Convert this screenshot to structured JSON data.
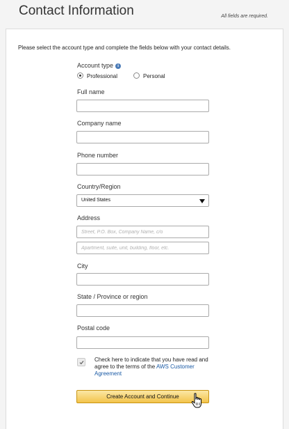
{
  "header": {
    "title": "Contact Information",
    "required_note": "All fields are required."
  },
  "intro": "Please select the account type and complete the fields below with your contact details.",
  "account_type": {
    "label": "Account type",
    "info_icon": "i",
    "options": [
      {
        "label": "Professional",
        "selected": true
      },
      {
        "label": "Personal",
        "selected": false
      }
    ]
  },
  "fields": {
    "full_name": {
      "label": "Full name",
      "value": ""
    },
    "company_name": {
      "label": "Company name",
      "value": ""
    },
    "phone_number": {
      "label": "Phone number",
      "value": ""
    },
    "country": {
      "label": "Country/Region",
      "value": "United States"
    },
    "address": {
      "label": "Address",
      "line1_placeholder": "Street, P.O. Box, Company Name, c/o",
      "line2_placeholder": "Apartment, suite, unit, building, floor, etc."
    },
    "city": {
      "label": "City",
      "value": ""
    },
    "state": {
      "label": "State / Province or region",
      "value": ""
    },
    "postal_code": {
      "label": "Postal code",
      "value": ""
    }
  },
  "agreement": {
    "checked": true,
    "text": "Check here to indicate that you have read and agree to the terms of the ",
    "link": "AWS Customer Agreement"
  },
  "submit_label": "Create Account and Continue",
  "icons": {
    "info": "info-icon",
    "checkmark": "checkmark-icon",
    "dropdown": "chevron-down-icon",
    "cursor": "hand-cursor-icon"
  },
  "colors": {
    "link": "#1a5aa5",
    "button_top": "#fbe7a6",
    "button_bottom": "#f3c44b",
    "info_icon": "#4a7bb7"
  }
}
